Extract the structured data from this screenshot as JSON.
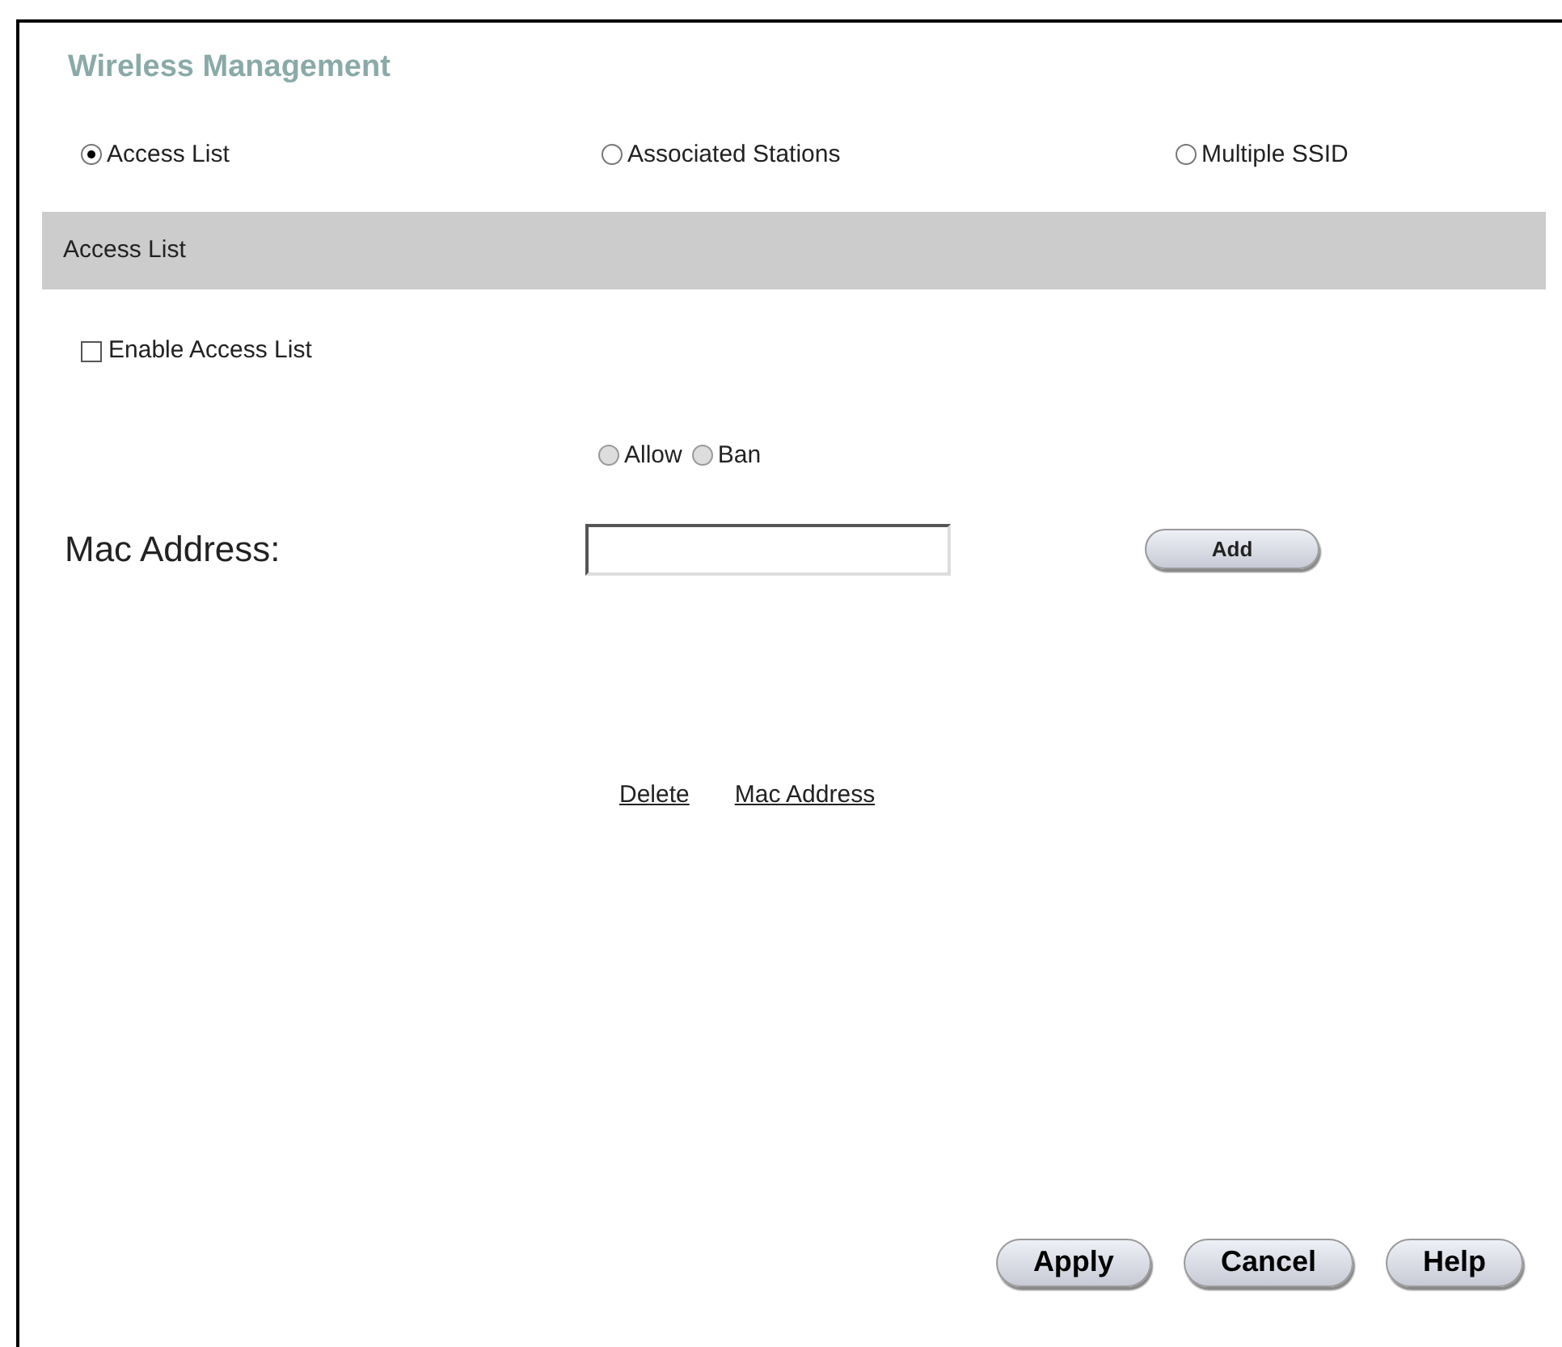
{
  "title": "Wireless Management",
  "tabs": [
    {
      "label": "Access List",
      "selected": true
    },
    {
      "label": "Associated Stations",
      "selected": false
    },
    {
      "label": "Multiple SSID",
      "selected": false
    }
  ],
  "section_header": "Access List",
  "enable_checkbox": {
    "label": "Enable Access List",
    "checked": false
  },
  "mode_radios": [
    {
      "label": "Allow",
      "selected": false,
      "disabled": true
    },
    {
      "label": "Ban",
      "selected": false,
      "disabled": true
    }
  ],
  "mac_field": {
    "label": "Mac Address:",
    "button": "Add"
  },
  "table": {
    "columns": [
      "Delete",
      "Mac Address"
    ]
  },
  "buttons": [
    "Apply",
    "Cancel",
    "Help"
  ]
}
